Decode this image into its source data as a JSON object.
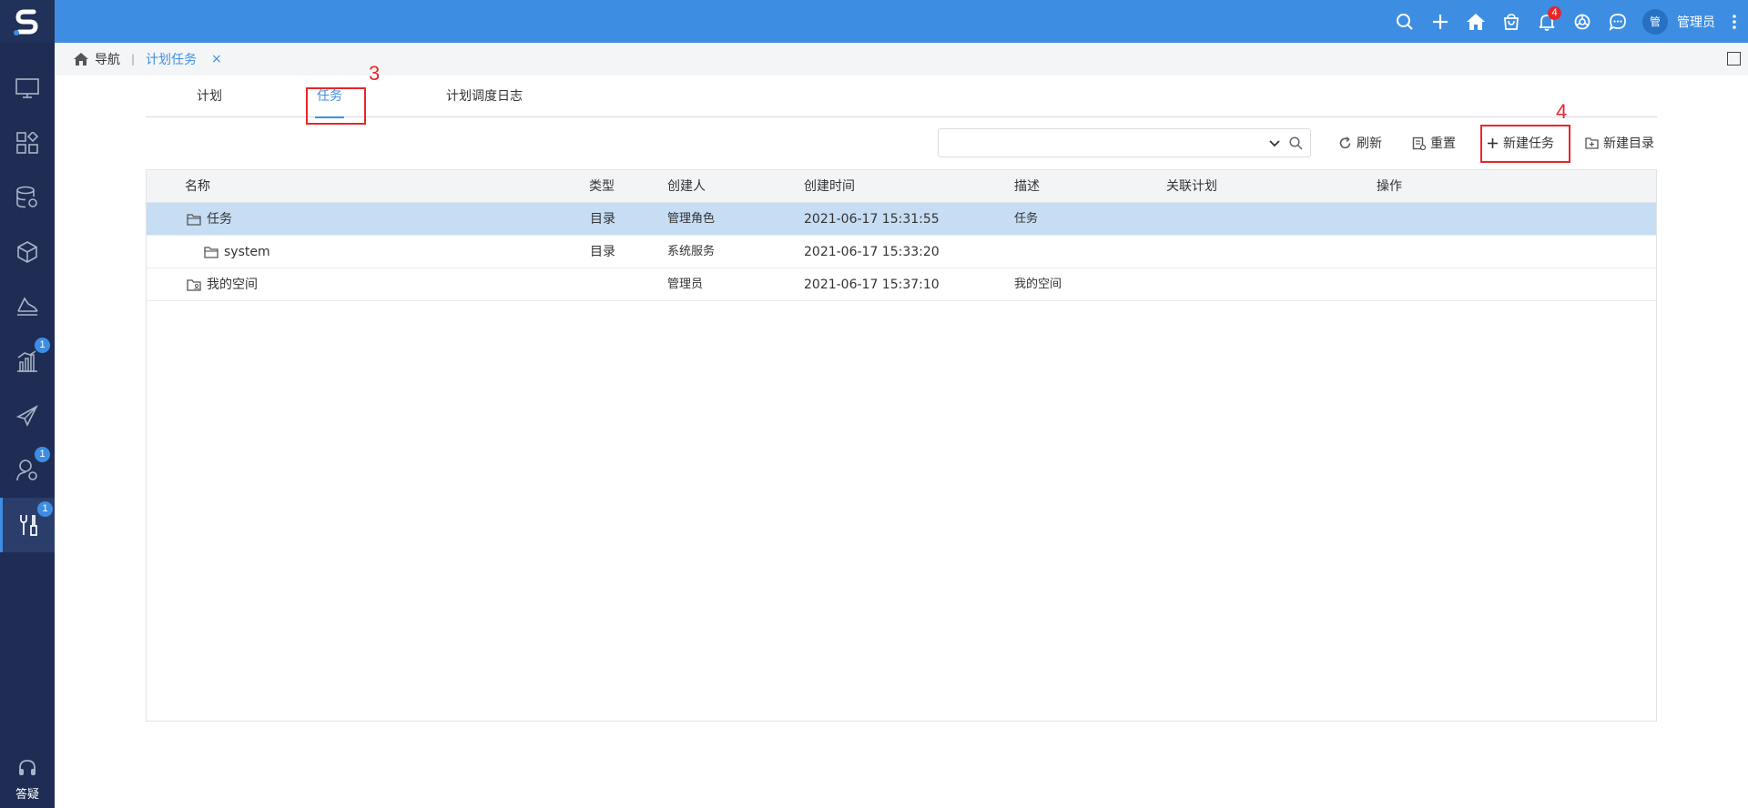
{
  "topbar": {
    "badge_count": "4",
    "username": "管理员",
    "avatar_text": "管"
  },
  "sidebar": {
    "badges": {
      "item6": "1",
      "item8": "1",
      "item9": "1"
    },
    "help_label": "答疑"
  },
  "breadcrumb": {
    "home_label": "导航",
    "separator": "|",
    "tab_label": "计划任务",
    "close_glyph": "×"
  },
  "tabs": [
    {
      "label": "计划"
    },
    {
      "label": "任务"
    },
    {
      "label": "计划调度日志"
    }
  ],
  "annotations": {
    "tab_marker": "3",
    "button_marker": "4"
  },
  "toolbar": {
    "search_value": "",
    "refresh_label": "刷新",
    "reset_label": "重置",
    "new_task_label": "新建任务",
    "new_folder_label": "新建目录"
  },
  "table": {
    "columns": [
      "名称",
      "类型",
      "创建人",
      "创建时间",
      "描述",
      "关联计划",
      "操作"
    ],
    "rows": [
      {
        "name": "任务",
        "type": "目录",
        "creator": "管理角色",
        "created": "2021-06-17 15:31:55",
        "desc": "任务",
        "plan": "",
        "ops": ""
      },
      {
        "name": "system",
        "type": "目录",
        "creator": "系统服务",
        "created": "2021-06-17 15:33:20",
        "desc": "",
        "plan": "",
        "ops": ""
      },
      {
        "name": "我的空间",
        "type": "",
        "creator": "管理员",
        "created": "2021-06-17 15:37:10",
        "desc": "我的空间",
        "plan": "",
        "ops": ""
      }
    ]
  },
  "colors": {
    "accent": "#3d8ee2",
    "sidebar": "#1f2d54",
    "selected_row": "#c6ddf4",
    "annotation": "#e8262a"
  }
}
